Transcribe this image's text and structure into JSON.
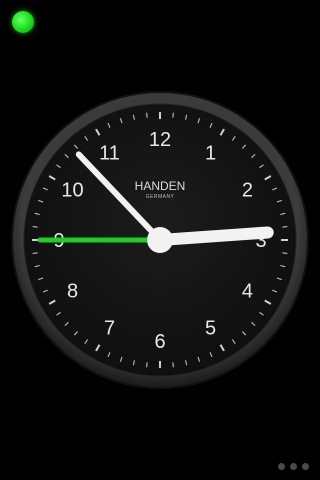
{
  "status_indicator": {
    "color": "#22e622"
  },
  "clock": {
    "brand": "HANDEN",
    "country": "GERMANY",
    "numerals": [
      "12",
      "1",
      "2",
      "3",
      "4",
      "5",
      "6",
      "7",
      "8",
      "9",
      "10",
      "11"
    ],
    "time": {
      "hour": 2,
      "minute": 52,
      "second": 45
    },
    "colors": {
      "face": "#161616",
      "bezel": "#3a3a3a",
      "hands": "#f2f2f2",
      "second_hand": "#22cc22",
      "numerals": "#e8e8e8",
      "ticks": "#d0d0d0"
    }
  },
  "page_indicator": {
    "count": 3,
    "active_index": -1
  }
}
